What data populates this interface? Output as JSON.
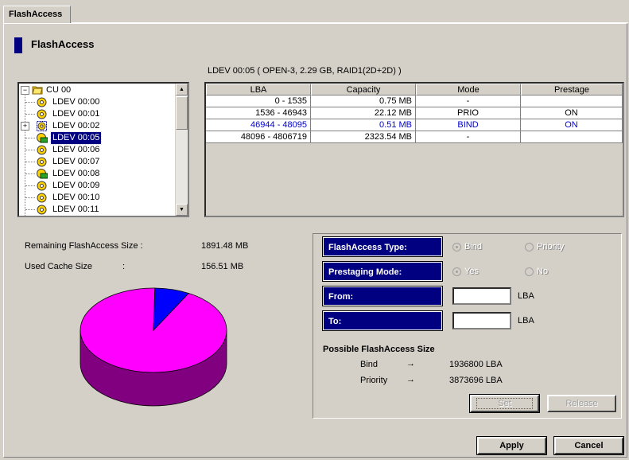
{
  "tab": {
    "label": "FlashAccess"
  },
  "header": {
    "title": "FlashAccess"
  },
  "ldev_caption": "LDEV 00:05 ( OPEN-3, 2.29 GB, RAID1(2D+2D) )",
  "tree": {
    "root": "CU 00",
    "items": [
      {
        "label": "LDEV 00:00"
      },
      {
        "label": "LDEV 00:01"
      },
      {
        "label": "LDEV 00:02"
      },
      {
        "label": "LDEV 00:05"
      },
      {
        "label": "LDEV 00:06"
      },
      {
        "label": "LDEV 00:07"
      },
      {
        "label": "LDEV 00:08"
      },
      {
        "label": "LDEV 00:09"
      },
      {
        "label": "LDEV 00:10"
      },
      {
        "label": "LDEV 00:11"
      }
    ],
    "selected": "LDEV 00:05"
  },
  "table": {
    "headers": [
      "LBA",
      "Capacity",
      "Mode",
      "Prestage"
    ],
    "rows": [
      {
        "lba": "0 - 1535",
        "capacity": "0.75 MB",
        "mode": "-",
        "prestage": ""
      },
      {
        "lba": "1536 - 46943",
        "capacity": "22.12 MB",
        "mode": "PRIO",
        "prestage": "ON"
      },
      {
        "lba": "46944 - 48095",
        "capacity": "0.51 MB",
        "mode": "BIND",
        "prestage": "ON"
      },
      {
        "lba": "48096 - 4806719",
        "capacity": "2323.54 MB",
        "mode": "-",
        "prestage": ""
      }
    ]
  },
  "sizes": {
    "remaining_label": "Remaining FlashAccess Size :",
    "remaining_value": "1891.48 MB",
    "used_label": "Used Cache Size",
    "used_colon": ":",
    "used_value": "156.51 MB"
  },
  "pie": {
    "used_fraction": 0.0765,
    "colors": {
      "free": "#ff00ff",
      "free_side": "#800080",
      "used": "#0000ff",
      "used_side": "#000080"
    }
  },
  "settings": {
    "type_label": "FlashAccess Type:",
    "type_options": [
      "Bind",
      "Priority"
    ],
    "type_selected": "Bind",
    "prestage_label": "Prestaging Mode:",
    "prestage_options": [
      "Yes",
      "No"
    ],
    "prestage_selected": "Yes",
    "from_label": "From:",
    "from_value": "",
    "to_label": "To:",
    "to_value": "",
    "unit": "LBA"
  },
  "possible": {
    "title": "Possible FlashAccess Size",
    "arrow": "→",
    "bind_label": "Bind",
    "bind_value": "1936800 LBA",
    "priority_label": "Priority",
    "priority_value": "3873696 LBA"
  },
  "buttons": {
    "set": "Set",
    "release": "Release",
    "apply": "Apply",
    "cancel": "Cancel"
  }
}
